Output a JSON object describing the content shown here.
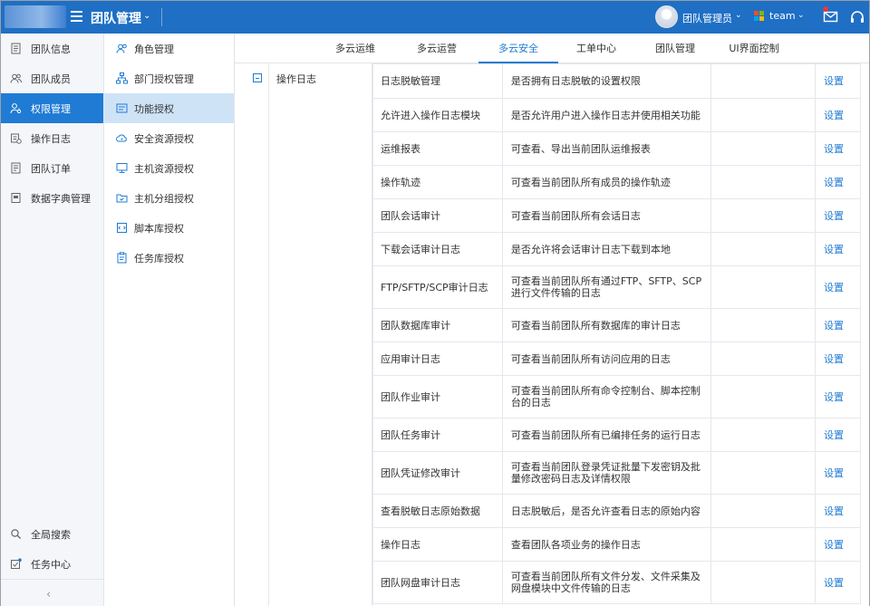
{
  "header": {
    "app_title": "团队管理",
    "user_name": "团队管理员",
    "team_name": "team",
    "colors": {
      "bar": "#1f6fc4",
      "accent": "#1f7bd4"
    }
  },
  "left_nav": {
    "items": [
      {
        "label": "团队信息",
        "icon": "doc-icon"
      },
      {
        "label": "团队成员",
        "icon": "users-icon"
      },
      {
        "label": "权限管理",
        "icon": "user-key-icon",
        "active": true
      },
      {
        "label": "操作日志",
        "icon": "log-icon"
      },
      {
        "label": "团队订单",
        "icon": "order-icon"
      },
      {
        "label": "数据字典管理",
        "icon": "dictionary-icon"
      }
    ],
    "bottom": [
      {
        "label": "全局搜索",
        "icon": "search-icon"
      },
      {
        "label": "任务中心",
        "icon": "task-icon"
      }
    ],
    "collapse_glyph": "‹"
  },
  "sub_nav": {
    "items": [
      {
        "label": "角色管理",
        "icon": "role-icon"
      },
      {
        "label": "部门授权管理",
        "icon": "org-tree-icon"
      },
      {
        "label": "功能授权",
        "icon": "function-icon",
        "active": true
      },
      {
        "label": "安全资源授权",
        "icon": "cloud-icon"
      },
      {
        "label": "主机资源授权",
        "icon": "monitor-icon"
      },
      {
        "label": "主机分组授权",
        "icon": "folder-icon"
      },
      {
        "label": "脚本库授权",
        "icon": "script-icon"
      },
      {
        "label": "任务库授权",
        "icon": "clipboard-icon"
      }
    ]
  },
  "tabs": [
    {
      "label": "多云运维"
    },
    {
      "label": "多云运营"
    },
    {
      "label": "多云安全",
      "active": true
    },
    {
      "label": "工单中心"
    },
    {
      "label": "团队管理"
    },
    {
      "label": "UI界面控制"
    }
  ],
  "group": {
    "label": "操作日志"
  },
  "permissions": [
    {
      "name": "日志脱敏管理",
      "desc": "是否拥有日志脱敏的设置权限",
      "action": "设置"
    },
    {
      "name": "允许进入操作日志模块",
      "desc": "是否允许用户进入操作日志并使用相关功能",
      "action": "设置"
    },
    {
      "name": "运维报表",
      "desc": "可查看、导出当前团队运维报表",
      "action": "设置"
    },
    {
      "name": "操作轨迹",
      "desc": "可查看当前团队所有成员的操作轨迹",
      "action": "设置"
    },
    {
      "name": "团队会话审计",
      "desc": "可查看当前团队所有会话日志",
      "action": "设置"
    },
    {
      "name": "下载会话审计日志",
      "desc": "是否允许将会话审计日志下载到本地",
      "action": "设置"
    },
    {
      "name": "FTP/SFTP/SCP审计日志",
      "desc": "可查看当前团队所有通过FTP、SFTP、SCP进行文件传输的日志",
      "action": "设置"
    },
    {
      "name": "团队数据库审计",
      "desc": "可查看当前团队所有数据库的审计日志",
      "action": "设置"
    },
    {
      "name": "应用审计日志",
      "desc": "可查看当前团队所有访问应用的日志",
      "action": "设置"
    },
    {
      "name": "团队作业审计",
      "desc": "可查看当前团队所有命令控制台、脚本控制台的日志",
      "action": "设置"
    },
    {
      "name": "团队任务审计",
      "desc": "可查看当前团队所有已编排任务的运行日志",
      "action": "设置"
    },
    {
      "name": "团队凭证修改审计",
      "desc": "可查看当前团队登录凭证批量下发密钥及批量修改密码日志及详情权限",
      "action": "设置"
    },
    {
      "name": "查看脱敏日志原始数据",
      "desc": "日志脱敏后，是否允许查看日志的原始内容",
      "action": "设置"
    },
    {
      "name": "操作日志",
      "desc": "查看团队各项业务的操作日志",
      "action": "设置"
    },
    {
      "name": "团队网盘审计日志",
      "desc": "可查看当前团队所有文件分发、文件采集及网盘模块中文件传输的日志",
      "action": "设置"
    }
  ]
}
